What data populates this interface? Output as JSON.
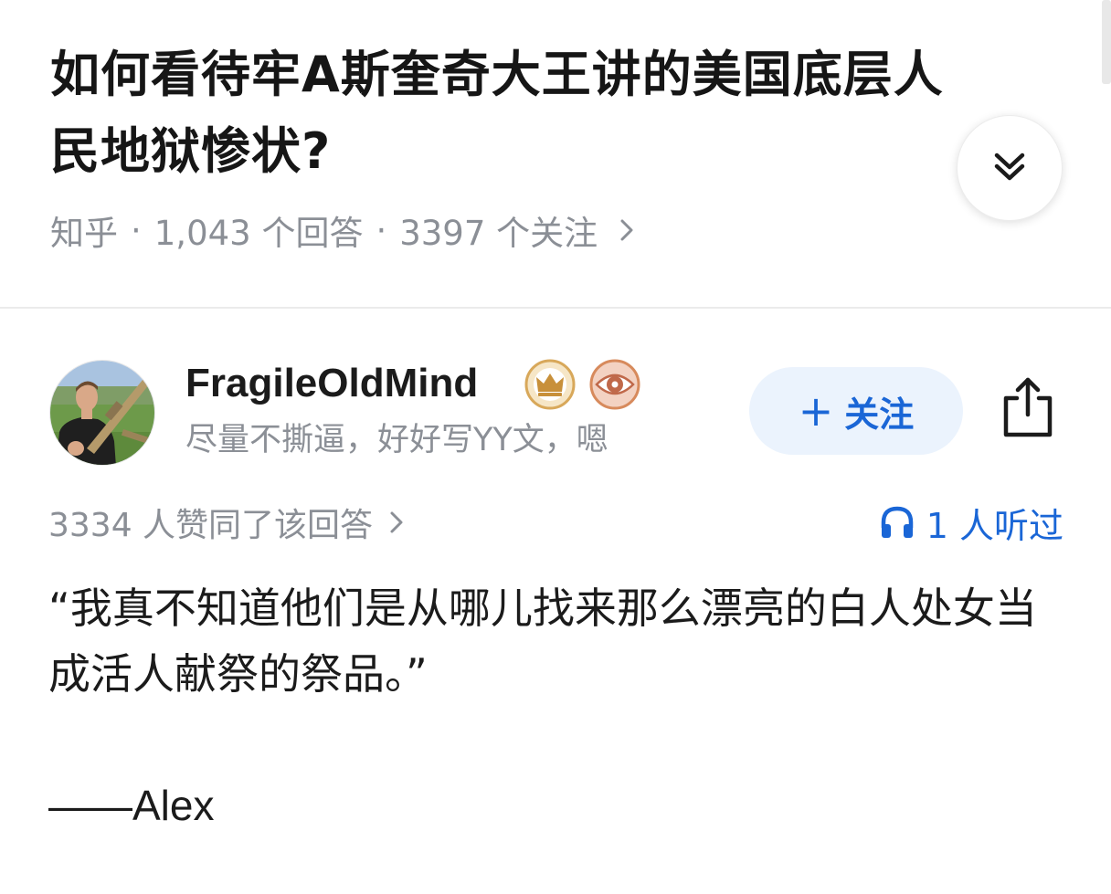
{
  "question": {
    "title": "如何看待牢A斯奎奇大王讲的美国底层人民地狱惨状?",
    "meta": {
      "source": "知乎",
      "answers": "1,043 个回答",
      "followers": "3397 个关注"
    }
  },
  "answer": {
    "author": {
      "name": "FragileOldMind",
      "bio": "尽量不撕逼，好好写YY文，嗯"
    },
    "follow_label": "关注",
    "likes": "3334 人赞同了该回答",
    "listened": "1 人听过",
    "quote": "“我真不知道他们是从哪儿找来那么漂亮的白人处女当成活人献祭的祭品。”",
    "signature": "——Alex"
  },
  "icons": {
    "collapse": "double-chevron-down-icon",
    "share": "share-icon",
    "headphones": "headphones-icon",
    "badge_crown": "crown-badge-icon",
    "badge_eye": "eye-badge-icon"
  },
  "colors": {
    "accent": "#1a66d6",
    "follow_bg": "#ebf3fd",
    "muted_text": "#8b8f96",
    "title_text": "#161616"
  }
}
